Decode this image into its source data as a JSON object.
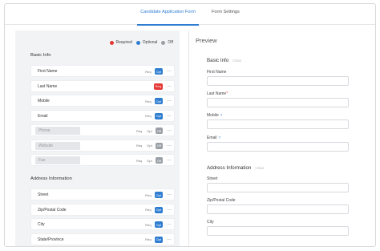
{
  "tabs": [
    {
      "label": "Candidate Application Form",
      "active": true
    },
    {
      "label": "Form Settings",
      "active": false
    }
  ],
  "legend": {
    "required": "Required",
    "optional": "Optional",
    "off": "Off",
    "colors": {
      "required": "#e53935",
      "optional": "#2f7dd1",
      "off": "#9aa0a6"
    }
  },
  "toggle_labels": {
    "req": "Req",
    "opt": "Opt",
    "off": "Off"
  },
  "more_icon": "…",
  "sections": {
    "basic": "Basic Info",
    "address": "Address Information"
  },
  "basic_fields": [
    {
      "label": "First Name",
      "state": "Opt"
    },
    {
      "label": "Last Name",
      "state": "Req"
    },
    {
      "label": "Mobile",
      "state": "Opt"
    },
    {
      "label": "Email",
      "state": "Opt"
    },
    {
      "label": "Phone",
      "state": "Off"
    },
    {
      "label": "Website",
      "state": "Off"
    },
    {
      "label": "Fax",
      "state": "Off"
    }
  ],
  "address_fields": [
    {
      "label": "Street",
      "state": "Opt"
    },
    {
      "label": "Zip/Postal Code",
      "state": "Opt"
    },
    {
      "label": "City",
      "state": "Opt"
    },
    {
      "label": "State/Province",
      "state": "Opt"
    }
  ],
  "preview": {
    "title": "Preview",
    "basic_title": "Basic Info",
    "address_title": "Address Information",
    "clear": "Clear",
    "fields": {
      "first_name": "First Name",
      "last_name": "Last Name",
      "mobile": "Mobile",
      "email": "Email",
      "street": "Street",
      "zip": "Zip/Postal Code",
      "city": "City"
    },
    "required_mark": "*",
    "help_icon": "?"
  }
}
